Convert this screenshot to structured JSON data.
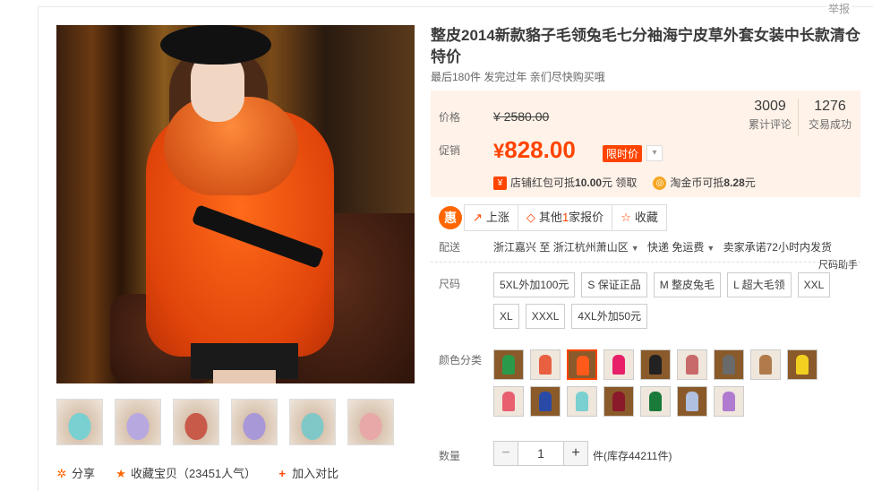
{
  "header": {
    "report_label": "举报"
  },
  "product": {
    "title": "整皮2014新款貉子毛领兔毛七分袖海宁皮草外套女装中长款清仓特价",
    "subtitle": "最后180件 发完过年 亲们尽快购买哦"
  },
  "price": {
    "price_label": "价格",
    "original": "¥ 2580.00",
    "promo_label": "促销",
    "promo_yen": "¥",
    "promo_value": "828.00",
    "limit_tag": "限时价"
  },
  "stats": {
    "reviews": "3009",
    "reviews_label": "累计评论",
    "deals": "1276",
    "deals_label": "交易成功"
  },
  "coupons": {
    "shop_coupon_prefix": "店铺红包可抵",
    "shop_coupon_amount": "10.00",
    "shop_coupon_suffix": "元 领取",
    "coin_prefix": "淘金币可抵",
    "coin_amount": "8.28",
    "coin_suffix": "元"
  },
  "actions": {
    "hui": "惠",
    "rise": "上涨",
    "other_prefix": "其他",
    "other_count": "1",
    "other_suffix": "家报价",
    "favorite": "收藏"
  },
  "shipping": {
    "label": "配送",
    "from": "浙江嘉兴",
    "to_word": "至",
    "to": "浙江杭州萧山区",
    "method": "快递 免运费",
    "promise": "卖家承诺72小时内发货",
    "size_chart": "尺码助手"
  },
  "sizes": {
    "label": "尺码",
    "options": [
      "5XL外加100元",
      "S 保证正品",
      "M 整皮兔毛",
      "L 超大毛领",
      "XXL",
      "XL",
      "XXXL",
      "4XL外加50元"
    ]
  },
  "colors": {
    "label": "颜色分类",
    "swatches": [
      "#2a9a4a",
      "#e86040",
      "#ff5a1a",
      "#e8206a",
      "#222222",
      "#c86a6a",
      "#6a6a6a",
      "#b07a4a",
      "#f2d020",
      "#e86070",
      "#2a4aa8",
      "#7ad0d0",
      "#8a1a2a",
      "#1a7a3a",
      "#b0c0e0",
      "#b07ad0"
    ],
    "selected_index": 2
  },
  "quantity": {
    "label": "数量",
    "minus": "−",
    "value": "1",
    "plus": "+",
    "stock": "件(库存44211件)"
  },
  "social": {
    "share": "分享",
    "favorite": "收藏宝贝（23451人气）",
    "compare": "加入对比"
  },
  "thumb_colors": [
    "#7ad0d0",
    "#b8a8e0",
    "#c85a4a",
    "#a898d8",
    "#80c8c8",
    "#e8a8a8"
  ]
}
